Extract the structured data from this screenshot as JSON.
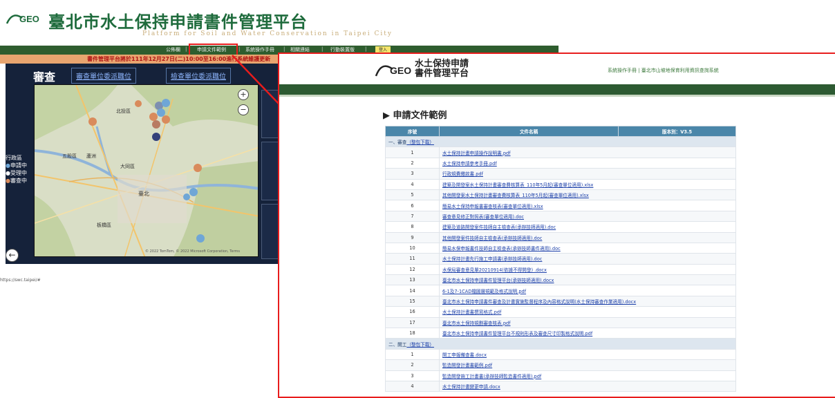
{
  "background": {
    "logo_text": "GEO",
    "title": "臺北市水土保持申請書件管理平台",
    "subtitle": "Platform for Soil and Water Conservation in Taipei City",
    "nav": [
      {
        "label": "公佈欄"
      },
      {
        "label": "申請文件範例"
      },
      {
        "label": "系統操作手冊"
      },
      {
        "label": "相關連結"
      },
      {
        "label": "行動裝置版"
      }
    ],
    "login_label": "登入",
    "notice": "書件管理平台將於111年12月27日(二)10:00至16:00進行系統維護更新",
    "review_title": "審查",
    "review_links": [
      "審查單位委派職位",
      "檢查單位委派職位"
    ],
    "legend": {
      "title": "行政區",
      "items": [
        "申請中",
        "受理中",
        "審查中"
      ]
    },
    "map_credit": "© 2022 TomTom, © 2022 Microsoft Corporation, Terms",
    "status_url": "https://swc.taipei/#"
  },
  "overlay": {
    "logo_text": "GEO",
    "brand_line1": "水土保持申請",
    "brand_line2": "書件管理平台",
    "top_links": "系統操作手冊 | 臺北市山坡地保育利用資訊查詢系統",
    "heading": "申請文件範例",
    "table_headers": {
      "num": "序號",
      "name": "文件名稱",
      "version": "版本別：V3.5"
    },
    "sections": [
      {
        "label": "一、審查",
        "download": "（整包下載）",
        "rows": [
          {
            "num": "1",
            "name": "水土保持計畫申請操作說明書.pdf"
          },
          {
            "num": "2",
            "name": "水土保持申請參考手冊.pdf"
          },
          {
            "num": "3",
            "name": "行政規費繳款書.pdf"
          },
          {
            "num": "4",
            "name": "建築及開發案水土保持計畫審查費核算表_110年5月起(審查單位適用).xlsx"
          },
          {
            "num": "5",
            "name": "其他開發案水土保持計畫審查費核算表_110年5月起(審查單位適用).xlsx"
          },
          {
            "num": "6",
            "name": "簡易水土保持申報書審查核表(審查單位適用).xlsx"
          },
          {
            "num": "7",
            "name": "審查意見修正對照表(審查單位適用).doc"
          },
          {
            "num": "8",
            "name": "建築及道路開發案件技師自主檢查表(承辦技師適用).doc"
          },
          {
            "num": "9",
            "name": "其他開發案件技師自主檢查表(承辦技師適用).doc"
          },
          {
            "num": "10",
            "name": "簡易水保申報書件技師自主檢查表(承辦技師書件適用).doc"
          },
          {
            "num": "11",
            "name": "水土保持計畫先行施工申請書(承辦技師適用).doc"
          },
          {
            "num": "12",
            "name": "水保局審查意見單20210914(依據不得開發) .docx"
          },
          {
            "num": "13",
            "name": "臺北市水土保持申請書件管理平台(承辦技師適用).docx"
          },
          {
            "num": "14",
            "name": "6-1及7-1CAD檔圖層規範及格式說明.pdf"
          },
          {
            "num": "15",
            "name": "臺北市水土保持申請書件審查及計畫實施監督程序及內容格式說明(水土保持審查作業適用).docx"
          },
          {
            "num": "16",
            "name": "水土保持計畫書撰寫格式.pdf"
          },
          {
            "num": "17",
            "name": "臺北市水土保持規劃審查核表.pdf"
          },
          {
            "num": "18",
            "name": "臺北市水土保持申請書件管理平台不規則形表及審查尺寸印製格式說明.pdf"
          }
        ]
      },
      {
        "label": "二、開工",
        "download": "（整包下載）",
        "rows": [
          {
            "num": "1",
            "name": "開工申報備查書.docx"
          },
          {
            "num": "2",
            "name": "監造開發計畫書範例.pdf"
          },
          {
            "num": "3",
            "name": "監造開發施工計畫書(承辦技師監造書件適用).pdf"
          },
          {
            "num": "4",
            "name": "水土保持計畫變更申請.docx"
          }
        ]
      }
    ]
  },
  "colors": {
    "nav_green": "#2e5d2e",
    "header_band": "#2d5a32",
    "table_header": "#4a86a9",
    "accent_red": "#e81c1c",
    "notice_bg": "#e8a56f"
  }
}
